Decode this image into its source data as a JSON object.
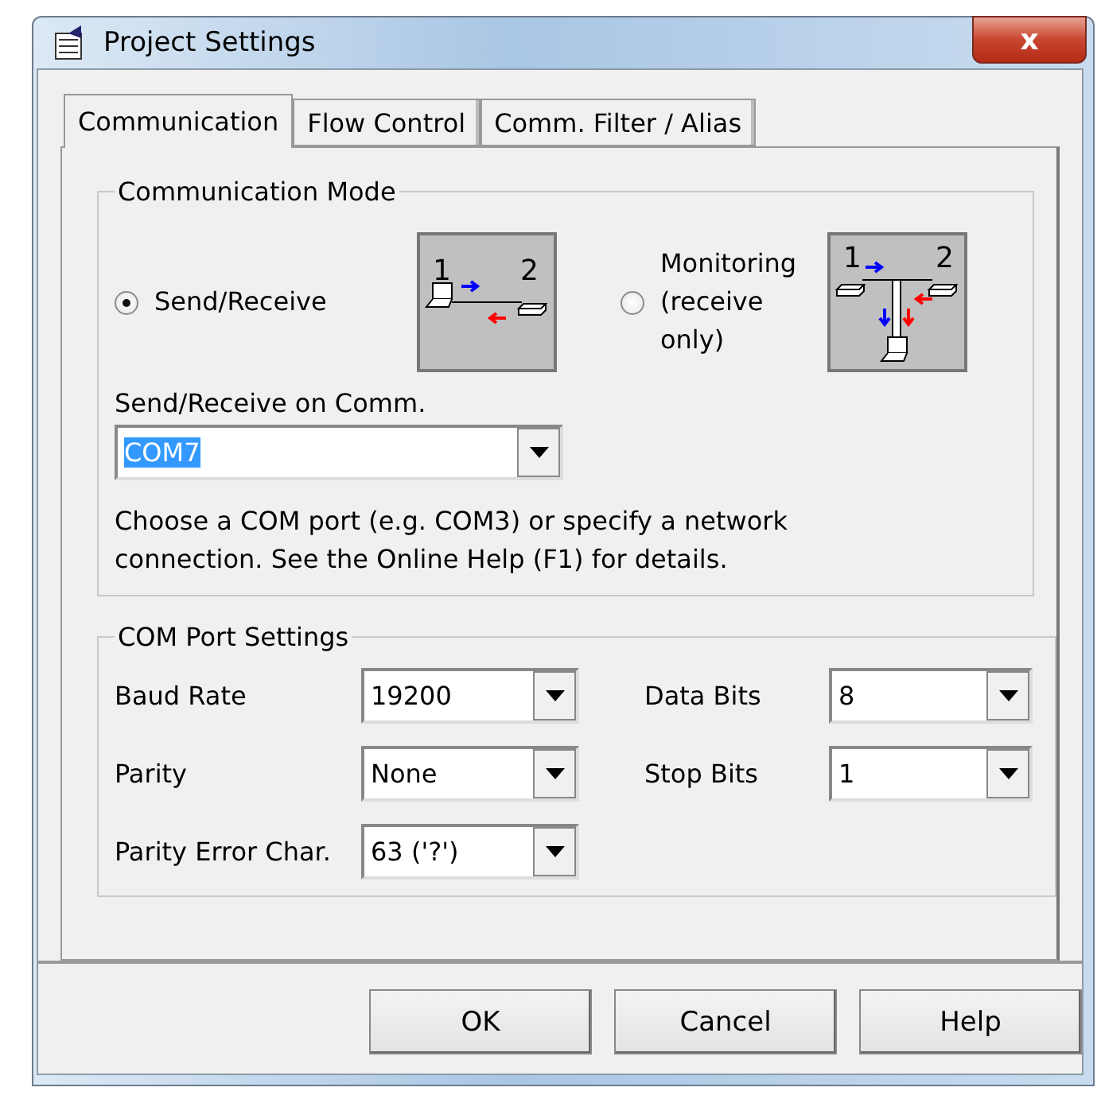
{
  "window": {
    "title": "Project Settings",
    "close": "x"
  },
  "tabs": [
    {
      "label": "Communication",
      "selected": true
    },
    {
      "label": "Flow Control",
      "selected": false
    },
    {
      "label": "Comm. Filter / Alias",
      "selected": false
    }
  ],
  "communication_mode": {
    "title": "Communication Mode",
    "modes": [
      {
        "label": "Send/Receive",
        "selected": true,
        "kind": "direct",
        "port_labels": [
          "1",
          "2"
        ]
      },
      {
        "label": "Monitoring (receive only)",
        "selected": false,
        "kind": "monitor",
        "port_labels": [
          "1",
          "2"
        ]
      }
    ],
    "comm_label": "Send/Receive on Comm.",
    "comm_value": "COM7",
    "comm_highlighted": true,
    "hint": "Choose a COM port (e.g. COM3) or specify a network connection. See the Online Help (F1) for details."
  },
  "com_port_settings": {
    "title": "COM Port Settings",
    "fields": [
      {
        "label": "Baud Rate",
        "value": "19200"
      },
      {
        "label": "Data Bits",
        "value": "8"
      },
      {
        "label": "Parity",
        "value": "None"
      },
      {
        "label": "Stop Bits",
        "value": "1"
      },
      {
        "label": "Parity Error Char.",
        "value": "63 ('?')"
      }
    ]
  },
  "buttons": [
    "OK",
    "Cancel",
    "Help"
  ]
}
